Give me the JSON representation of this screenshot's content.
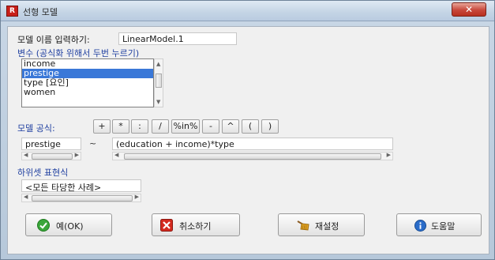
{
  "window": {
    "title": "선형 모델",
    "app_icon_glyph": "R",
    "close_glyph": "✕"
  },
  "model_name": {
    "label": "모델 이름 입력하기:",
    "value": "LinearModel.1"
  },
  "variables": {
    "label": "변수 (공식화 위해서 두번 누르기)",
    "items": [
      "income",
      "prestige",
      "type [요인]",
      "women"
    ],
    "selected_index": 1
  },
  "formula": {
    "label": "모델 공식:",
    "operators": [
      "+",
      "*",
      ":",
      "/",
      "%in%",
      "-",
      "^",
      "(",
      ")"
    ],
    "lhs": "prestige",
    "tilde": "~",
    "rhs": "(education + income)*type"
  },
  "subset": {
    "label": "하위셋 표현식",
    "value": "<모든 타당한 사례>"
  },
  "buttons": {
    "ok": "예(OK)",
    "cancel": "취소하기",
    "reset": "재설정",
    "help": "도움말"
  },
  "colors": {
    "label_blue": "#1f3fa0",
    "selection": "#3a78d8",
    "ok_icon": "#3aa63a",
    "cancel_icon": "#d32a1f",
    "help_icon": "#2a6cc9"
  },
  "icons": {
    "ok": "check-icon",
    "cancel": "x-icon",
    "reset": "broom-icon",
    "help": "info-icon",
    "app": "r-app-icon"
  }
}
